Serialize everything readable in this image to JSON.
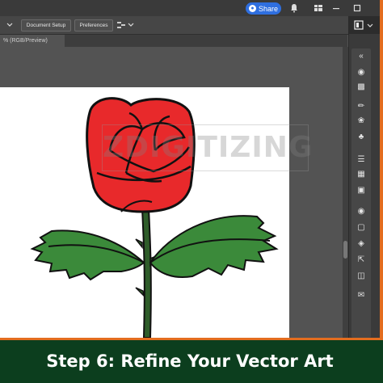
{
  "appbar": {
    "share_label": "Share"
  },
  "controlbar": {
    "document_setup_label": "Document Setup",
    "preferences_label": "Preferences"
  },
  "document_tab": {
    "label": "% (RGB/Preview)"
  },
  "artwork": {
    "subject": "red rose with green leaves",
    "watermark": "ZDIGITIZING"
  },
  "caption": {
    "text": "Step 6: Refine Your Vector Art"
  },
  "colors": {
    "frame": "#e36d1f",
    "caption_bg": "#0c3e1e",
    "share_button": "#2f6fe0",
    "rose": "#e8292b",
    "leaf": "#3b8a3a",
    "stem": "#2f5d2a"
  },
  "icons": {
    "panel": [
      "properties-icon",
      "layers-icon",
      "libraries-icon",
      "brush-icon",
      "symbol-icon",
      "club-icon",
      "align-icon",
      "gradient-icon",
      "transparency-icon",
      "appearance-icon",
      "stroke-icon",
      "export-icon",
      "comment-icon"
    ]
  }
}
